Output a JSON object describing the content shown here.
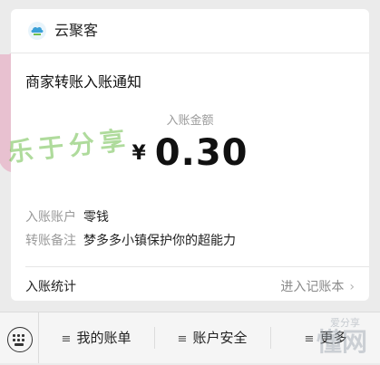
{
  "header": {
    "app_name": "云聚客",
    "app_icon": "cloud-logo-icon"
  },
  "notice": {
    "title": "商家转账入账通知"
  },
  "amount": {
    "label": "入账金额",
    "currency": "¥",
    "value": "0.30"
  },
  "details": [
    {
      "key": "入账账户",
      "value": "零钱"
    },
    {
      "key": "转账备注",
      "value": "梦多多小镇保护你的超能力"
    }
  ],
  "footer": {
    "stats_label": "入账统计",
    "ledger_label": "进入记账本",
    "ledger_chevron": "chevron-right-icon"
  },
  "bottom_bar": {
    "keyboard_icon": "keyboard-icon",
    "menus": [
      {
        "label": "我的账单"
      },
      {
        "label": "账户安全"
      },
      {
        "label": "更多"
      }
    ]
  },
  "overlay": {
    "sticker_text": "乐于分享",
    "watermark": "懂网",
    "watermark_sub": "爱分享"
  },
  "colors": {
    "background": "#ebebeb",
    "card": "#ffffff",
    "accent_green": "#6fbf4d",
    "accent_pink": "#e58fb0"
  }
}
